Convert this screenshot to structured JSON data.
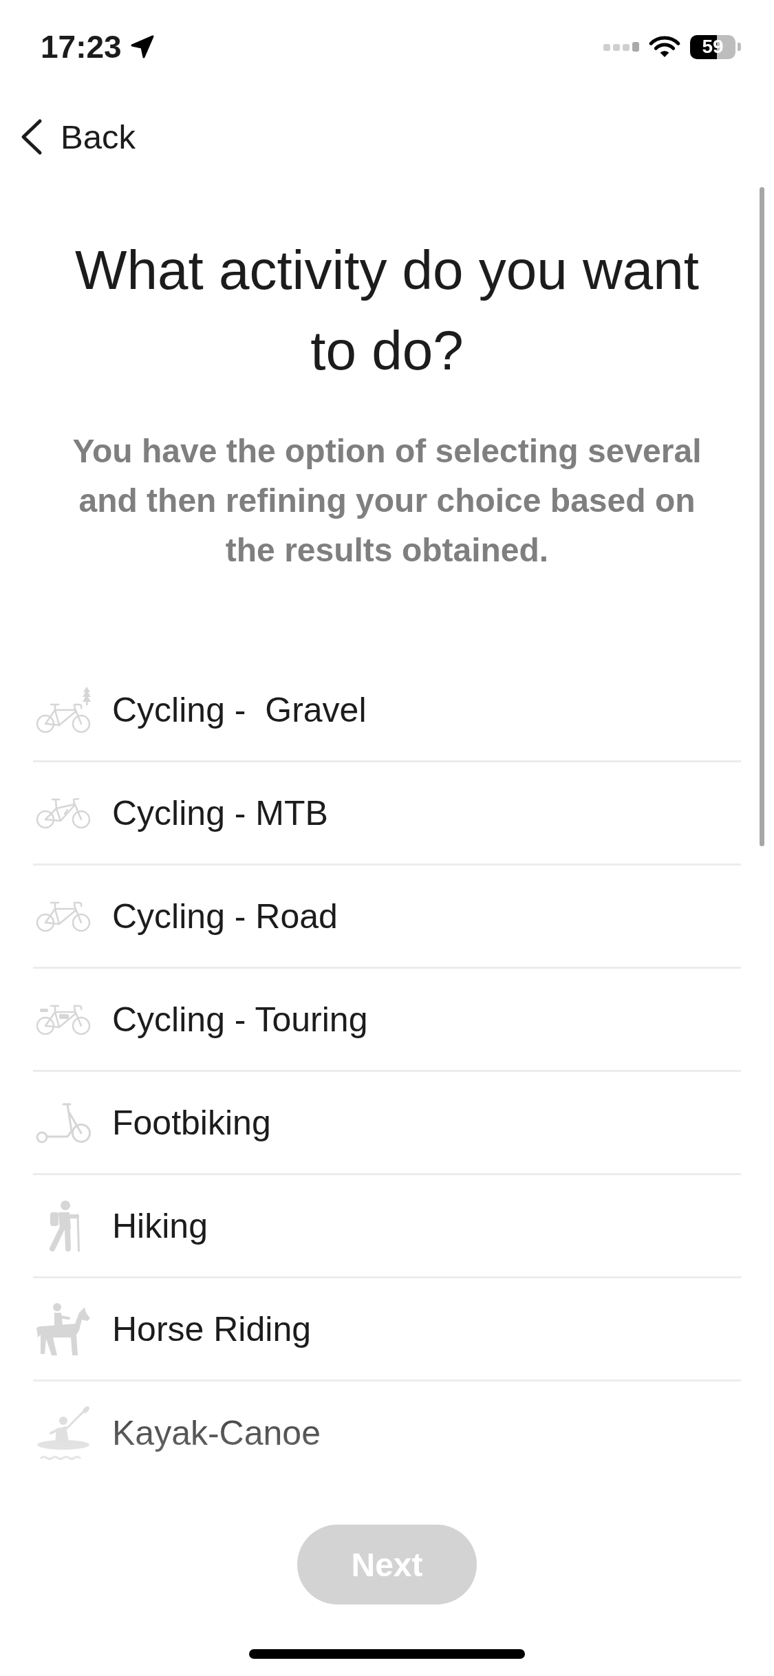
{
  "status_bar": {
    "time": "17:23",
    "battery": "59"
  },
  "nav": {
    "back": "Back"
  },
  "title": "What activity do you want to do?",
  "subtitle": "You have the option of selecting several and then refining your choice based on the results obtained.",
  "activities": [
    {
      "label": "Cycling -  Gravel",
      "selected": false
    },
    {
      "label": "Cycling - MTB",
      "selected": false
    },
    {
      "label": "Cycling - Road",
      "selected": false
    },
    {
      "label": "Cycling - Touring",
      "selected": false
    },
    {
      "label": "Footbiking",
      "selected": false
    },
    {
      "label": "Hiking",
      "selected": false
    },
    {
      "label": "Horse Riding",
      "selected": false
    },
    {
      "label": "Kayak-Canoe",
      "selected": false
    }
  ],
  "next_button": {
    "label": "Next",
    "disabled": true
  }
}
